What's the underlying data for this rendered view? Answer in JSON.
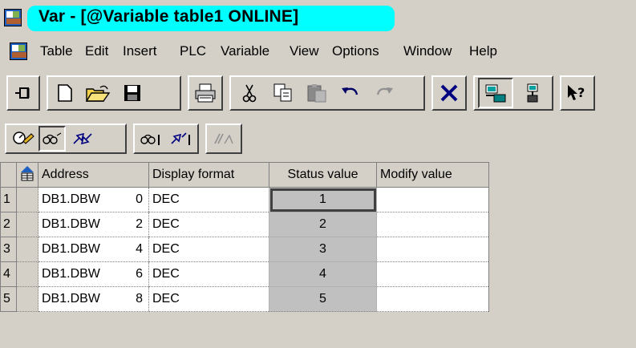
{
  "window": {
    "title": "Var - [@Variable table1  ONLINE]"
  },
  "menu": [
    "Table",
    "Edit",
    "Insert",
    "PLC",
    "Variable",
    "View",
    "Options",
    "Window",
    "Help"
  ],
  "toolbar": {
    "buttons": [
      "pin-icon",
      "new-icon",
      "open-icon",
      "save-icon",
      "print-icon",
      "cut-icon",
      "copy-icon",
      "paste-icon",
      "undo-icon",
      "redo-icon",
      "delete-icon",
      "online-icon",
      "network-icon",
      "help-icon"
    ]
  },
  "toolbar2": {
    "buttons": [
      "monitor-icon",
      "monitor-variable-icon",
      "modify-variable-icon",
      "update-monitor-icon",
      "activate-modify-icon",
      "force-icon"
    ]
  },
  "table": {
    "headers": {
      "address": "Address",
      "display_format": "Display format",
      "status_value": "Status value",
      "modify_value": "Modify value"
    },
    "rows": [
      {
        "num": "1",
        "addr": "DB1.DBW",
        "offset": "0",
        "format": "DEC",
        "status": "1",
        "modify": ""
      },
      {
        "num": "2",
        "addr": "DB1.DBW",
        "offset": "2",
        "format": "DEC",
        "status": "2",
        "modify": ""
      },
      {
        "num": "3",
        "addr": "DB1.DBW",
        "offset": "4",
        "format": "DEC",
        "status": "3",
        "modify": ""
      },
      {
        "num": "4",
        "addr": "DB1.DBW",
        "offset": "6",
        "format": "DEC",
        "status": "4",
        "modify": ""
      },
      {
        "num": "5",
        "addr": "DB1.DBW",
        "offset": "8",
        "format": "DEC",
        "status": "5",
        "modify": ""
      }
    ]
  },
  "colors": {
    "title_highlight": "#00ffff",
    "window_bg": "#d4d0c8",
    "status_cell": "#c0c0c0"
  }
}
